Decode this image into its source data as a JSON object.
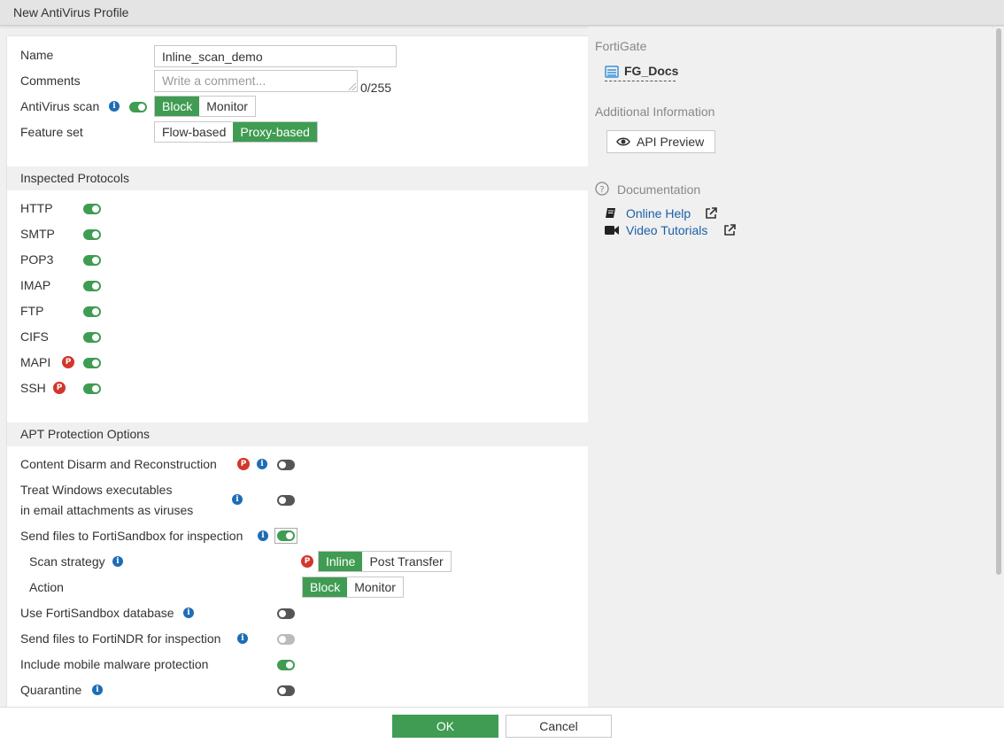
{
  "window": {
    "title": "New AntiVirus Profile"
  },
  "form": {
    "name_label": "Name",
    "name_value": "Inline_scan_demo",
    "comments_label": "Comments",
    "comments_placeholder": "Write a comment...",
    "comments_counter": "0/255",
    "antivirus_label": "AntiVirus scan",
    "antivirus_enabled": true,
    "antivirus_options": [
      "Block",
      "Monitor"
    ],
    "antivirus_selected": "Block",
    "featureset_label": "Feature set",
    "featureset_options": [
      "Flow-based",
      "Proxy-based"
    ],
    "featureset_selected": "Proxy-based"
  },
  "protocols": {
    "title": "Inspected Protocols",
    "items": [
      {
        "label": "HTTP",
        "enabled": true,
        "proxy_only": false
      },
      {
        "label": "SMTP",
        "enabled": true,
        "proxy_only": false
      },
      {
        "label": "POP3",
        "enabled": true,
        "proxy_only": false
      },
      {
        "label": "IMAP",
        "enabled": true,
        "proxy_only": false
      },
      {
        "label": "FTP",
        "enabled": true,
        "proxy_only": false
      },
      {
        "label": "CIFS",
        "enabled": true,
        "proxy_only": false
      },
      {
        "label": "MAPI",
        "enabled": true,
        "proxy_only": true
      },
      {
        "label": "SSH",
        "enabled": true,
        "proxy_only": true
      }
    ]
  },
  "apt": {
    "title": "APT Protection Options",
    "cdr_label": "Content Disarm and Reconstruction",
    "cdr_enabled": false,
    "treat_exe_label_1": "Treat Windows executables",
    "treat_exe_label_2": "in email attachments as viruses",
    "treat_exe_enabled": false,
    "sandbox_label": "Send files to FortiSandbox for inspection",
    "sandbox_enabled": true,
    "scan_strategy_label": "Scan strategy",
    "scan_strategy_options": [
      "Inline",
      "Post Transfer"
    ],
    "scan_strategy_selected": "Inline",
    "action_label": "Action",
    "action_options": [
      "Block",
      "Monitor"
    ],
    "action_selected": "Block",
    "sandbox_db_label": "Use FortiSandbox database",
    "sandbox_db_enabled": false,
    "fortindr_label": "Send files to FortiNDR for inspection",
    "fortindr_enabled": false,
    "mobile_label": "Include mobile malware protection",
    "mobile_enabled": true,
    "quarantine_label": "Quarantine",
    "quarantine_enabled": false,
    "badge_letter": "P",
    "info_letter": "i"
  },
  "sidebar": {
    "fortigate_heading": "FortiGate",
    "device_name": "FG_Docs",
    "additional_heading": "Additional Information",
    "api_preview_label": "API Preview",
    "documentation_heading": "Documentation",
    "online_help_label": "Online Help",
    "video_tutorials_label": "Video Tutorials"
  },
  "footer": {
    "ok_label": "OK",
    "cancel_label": "Cancel"
  },
  "colors": {
    "accent_green": "#3f9c52",
    "info_blue": "#1d6db5",
    "proxy_badge_red": "#d3362a",
    "link_blue": "#1d5fa8"
  }
}
